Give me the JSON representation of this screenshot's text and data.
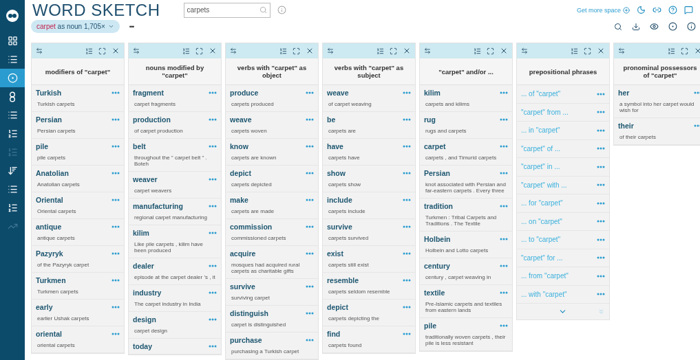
{
  "sidebar": {
    "items": [
      {
        "selected": false,
        "disabled": false
      },
      {
        "selected": false,
        "disabled": false
      },
      {
        "selected": true,
        "disabled": false
      },
      {
        "selected": false,
        "disabled": false
      },
      {
        "selected": false,
        "disabled": false
      },
      {
        "selected": false,
        "disabled": false
      },
      {
        "selected": false,
        "disabled": true
      },
      {
        "selected": false,
        "disabled": false
      },
      {
        "selected": false,
        "disabled": false
      },
      {
        "selected": false,
        "disabled": false
      },
      {
        "selected": false,
        "disabled": true
      }
    ]
  },
  "header": {
    "title": "WORD SKETCH",
    "search": {
      "value": "carpets"
    },
    "more_space": "Get more space"
  },
  "query": {
    "lemma": "carpet",
    "rest": "as noun 1,705×",
    "more": "•••"
  },
  "columns": [
    {
      "kind": "collocations",
      "title": "modifiers of \"carpet\"",
      "items": [
        {
          "word": "Turkish",
          "example": "Turkish carpets"
        },
        {
          "word": "Persian",
          "example": "Persian carpets"
        },
        {
          "word": "pile",
          "example": "pile carpets"
        },
        {
          "word": "Anatolian",
          "example": "Anatolian carpets"
        },
        {
          "word": "Oriental",
          "example": "Oriental carpets"
        },
        {
          "word": "antique",
          "example": "antique carpets"
        },
        {
          "word": "Pazyryk",
          "example": "of the Pazyryk carpet"
        },
        {
          "word": "Turkmen",
          "example": "Turkmen carpets"
        },
        {
          "word": "early",
          "example": "earlier Ushak carpets"
        },
        {
          "word": "oriental",
          "example": "oriental carpets"
        }
      ]
    },
    {
      "kind": "collocations",
      "title": "nouns modified by \"carpet\"",
      "items": [
        {
          "word": "fragment",
          "example": "carpet fragments"
        },
        {
          "word": "production",
          "example": "of carpet production"
        },
        {
          "word": "belt",
          "example": "throughout the \" carpet belt \" . Boteh"
        },
        {
          "word": "weaver",
          "example": "carpet weavers"
        },
        {
          "word": "manufacturing",
          "example": "regional carpet manufacturing"
        },
        {
          "word": "kilim",
          "example": "Like pile carpets , kilim have been produced"
        },
        {
          "word": "dealer",
          "example": "episode at the carpet dealer 's , it"
        },
        {
          "word": "industry",
          "example": "The carpet industry in India"
        },
        {
          "word": "design",
          "example": "carpet design"
        },
        {
          "word": "today"
        }
      ]
    },
    {
      "kind": "collocations",
      "title": "verbs with \"carpet\" as object",
      "items": [
        {
          "word": "produce",
          "example": "carpets produced"
        },
        {
          "word": "weave",
          "example": "carpets woven"
        },
        {
          "word": "know",
          "example": "carpets are known"
        },
        {
          "word": "depict",
          "example": "carpets depicted"
        },
        {
          "word": "make",
          "example": "carpets are made"
        },
        {
          "word": "commission",
          "example": "commissioned carpets"
        },
        {
          "word": "acquire",
          "example": "mosques had acquired rural carpets as charitable gifts"
        },
        {
          "word": "survive",
          "example": "surviving carpet"
        },
        {
          "word": "distinguish",
          "example": "carpet is distinguished"
        },
        {
          "word": "purchase",
          "example": "purchasing a Turkish carpet"
        }
      ]
    },
    {
      "kind": "collocations",
      "title": "verbs with \"carpet\" as subject",
      "items": [
        {
          "word": "weave",
          "example": "of carpet weaving"
        },
        {
          "word": "be",
          "example": "carpets are"
        },
        {
          "word": "have",
          "example": "carpets have"
        },
        {
          "word": "show",
          "example": "carpets show"
        },
        {
          "word": "include",
          "example": "carpets include"
        },
        {
          "word": "survive",
          "example": "carpets survived"
        },
        {
          "word": "exist",
          "example": "carpets still exist"
        },
        {
          "word": "resemble",
          "example": "carpets seldom resemble"
        },
        {
          "word": "depict",
          "example": "carpets depicting the"
        },
        {
          "word": "find",
          "example": "carpets found"
        }
      ]
    },
    {
      "kind": "collocations",
      "title": "\"carpet\" and/or ...",
      "items": [
        {
          "word": "kilim",
          "example": "carpets and kilims"
        },
        {
          "word": "rug",
          "example": "rugs and carpets"
        },
        {
          "word": "carpet",
          "example": "carpets , and Timurid carpets"
        },
        {
          "word": "Persian",
          "example": "knot associated with Persian and far-eastern carpets . Every three"
        },
        {
          "word": "tradition",
          "example": "Turkmen : Tribal Carpets and Traditions . The Textile"
        },
        {
          "word": "Holbein",
          "example": "Holbein and Lotto carpets"
        },
        {
          "word": "century",
          "example": "century , carpet weaving in"
        },
        {
          "word": "textile",
          "example": "Pre-Islamic carpets and textiles from eastern lands"
        },
        {
          "word": "pile",
          "example": "traditionally woven carpets , their pile is less resistant"
        }
      ]
    },
    {
      "kind": "phrases",
      "title": "prepositional phrases",
      "items": [
        {
          "word": "... of \"carpet\""
        },
        {
          "word": "\"carpet\" from ..."
        },
        {
          "word": "... in \"carpet\""
        },
        {
          "word": "\"carpet\" of ..."
        },
        {
          "word": "\"carpet\" in ..."
        },
        {
          "word": "\"carpet\" with ..."
        },
        {
          "word": "... for \"carpet\""
        },
        {
          "word": "... on \"carpet\""
        },
        {
          "word": "... to \"carpet\""
        },
        {
          "word": "\"carpet\" for ..."
        },
        {
          "word": "... from \"carpet\""
        },
        {
          "word": "... with \"carpet\""
        }
      ]
    },
    {
      "kind": "collocations",
      "title": "pronominal possessors of \"carpet\"",
      "items": [
        {
          "word": "her",
          "example": "a symbol into her carpet would wish for"
        },
        {
          "word": "their",
          "example": "of their carpets"
        }
      ]
    }
  ]
}
